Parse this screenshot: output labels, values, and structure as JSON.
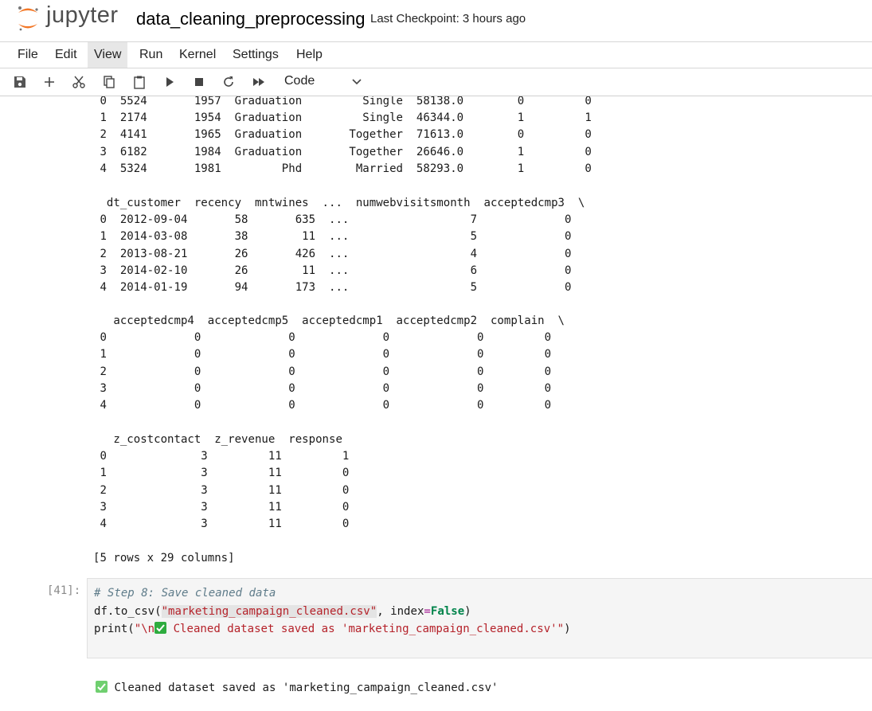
{
  "header": {
    "logo_text": "jupyter",
    "notebook_title": "data_cleaning_preprocessing",
    "checkpoint": "Last Checkpoint: 3 hours ago"
  },
  "menu": [
    "File",
    "Edit",
    "View",
    "Run",
    "Kernel",
    "Settings",
    "Help"
  ],
  "active_menu": "View",
  "toolbar": {
    "icons": [
      "save-icon",
      "add-cell-icon",
      "cut-icon",
      "copy-icon",
      "paste-icon",
      "run-icon",
      "stop-icon",
      "restart-icon",
      "fast-forward-icon"
    ],
    "cell_type": "Code"
  },
  "output": {
    "block1": " 0  5524       1957  Graduation         Single  58138.0        0         0\n 1  2174       1954  Graduation         Single  46344.0        1         1\n 2  4141       1965  Graduation       Together  71613.0        0         0\n 3  6182       1984  Graduation       Together  26646.0        1         0\n 4  5324       1981         Phd        Married  58293.0        1         0",
    "block2": "  dt_customer  recency  mntwines  ...  numwebvisitsmonth  acceptedcmp3  \\\n 0  2012-09-04       58       635  ...                  7             0\n 1  2014-03-08       38        11  ...                  5             0\n 2  2013-08-21       26       426  ...                  4             0\n 3  2014-02-10       26        11  ...                  6             0\n 4  2014-01-19       94       173  ...                  5             0",
    "block3": "   acceptedcmp4  acceptedcmp5  acceptedcmp1  acceptedcmp2  complain  \\\n 0             0             0             0             0         0\n 1             0             0             0             0         0\n 2             0             0             0             0         0\n 3             0             0             0             0         0\n 4             0             0             0             0         0",
    "block4": "   z_costcontact  z_revenue  response\n 0              3         11         1\n 1              3         11         0\n 2              3         11         0\n 3              3         11         0\n 4              3         11         0",
    "summary": "[5 rows x 29 columns]"
  },
  "code_cell": {
    "prompt": "[41]:",
    "comment": "# Step 8: Save cleaned data",
    "line2_a": "df.to_csv(",
    "line2_str": "\"marketing_campaign_cleaned.csv\"",
    "line2_b": ", index",
    "line2_eq": "=",
    "line2_kw": "False",
    "line2_c": ")",
    "line3_a": "print(",
    "line3_str1": "\"\\n",
    "line3_str2": " Cleaned dataset saved as 'marketing_campaign_cleaned.csv'\"",
    "line3_b": ")"
  },
  "result": {
    "text": " Cleaned dataset saved as 'marketing_campaign_cleaned.csv'"
  }
}
